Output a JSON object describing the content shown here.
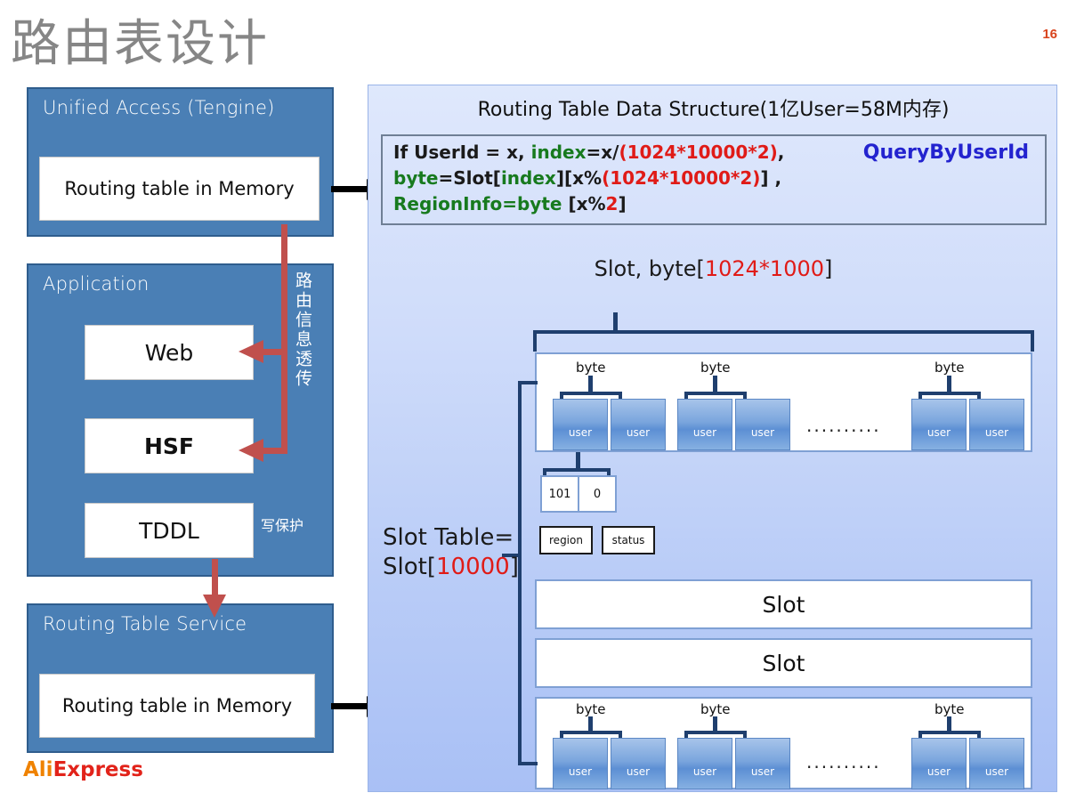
{
  "slide": {
    "title": "路由表设计",
    "number": "16",
    "brand_a": "Ali",
    "brand_b": "Express"
  },
  "left": {
    "access": {
      "title": "Unified Access  (Tengine)",
      "box_label": "Routing table in Memory"
    },
    "application": {
      "title": "Application",
      "items": [
        {
          "label": "Web"
        },
        {
          "label": "HSF"
        },
        {
          "label": "TDDL"
        }
      ],
      "vertical_label": "路由信息透传",
      "write_protect_label": "写保护"
    },
    "routing_table_service": {
      "title": "Routing Table Service",
      "box_label": "Routing table in Memory"
    }
  },
  "right": {
    "header": "Routing Table Data Structure(1亿User=58M内存)",
    "query_label": "QueryByUserId",
    "formula": {
      "line1": [
        {
          "t": "If UserId = x, ",
          "c": "k"
        },
        {
          "t": "index",
          "c": "g"
        },
        {
          "t": "=x/",
          "c": "k"
        },
        {
          "t": "(1024*10000*2)",
          "c": "r"
        },
        {
          "t": ",",
          "c": "k"
        }
      ],
      "line2": [
        {
          "t": "byte",
          "c": "g"
        },
        {
          "t": "=Slot[",
          "c": "k"
        },
        {
          "t": "index",
          "c": "g"
        },
        {
          "t": "][x%",
          "c": "k"
        },
        {
          "t": "(1024*10000*2)",
          "c": "r"
        },
        {
          "t": "] ,",
          "c": "k"
        }
      ],
      "line3": [
        {
          "t": "RegionInfo=byte",
          "c": "g"
        },
        {
          "t": " [x%",
          "c": "k"
        },
        {
          "t": "2",
          "c": "r"
        },
        {
          "t": "]",
          "c": "k"
        }
      ]
    },
    "slot_byte_label": [
      {
        "t": "Slot, byte[",
        "c": "k"
      },
      {
        "t": "1024*1000",
        "c": "r"
      },
      {
        "t": "]",
        "c": "k"
      }
    ],
    "slot_table_label": [
      {
        "t": "Slot Table=",
        "c": "k"
      },
      {
        "t": "\n",
        "c": "k"
      },
      {
        "t": "Slot[",
        "c": "k"
      },
      {
        "t": "10000",
        "c": "r"
      },
      {
        "t": "]",
        "c": "k"
      }
    ],
    "byte_label": "byte",
    "user_label": "user",
    "ellipsis": "..........",
    "slot_row_label": "Slot",
    "detail": {
      "cells": [
        "101",
        "0"
      ],
      "tags": [
        "region",
        "status"
      ]
    }
  },
  "colors": {
    "panel_blue": "#4a7fb5",
    "panel_border": "#2f5d8d",
    "accent_red": "#e01b17",
    "accent_green": "#177a1e",
    "accent_blue": "#2323cf",
    "brand_orange": "#ef8200",
    "brand_red": "#e2231a",
    "connector_red": "#c0504d",
    "bracket_navy": "#1f3f6e",
    "slide_number": "#d8431c"
  }
}
